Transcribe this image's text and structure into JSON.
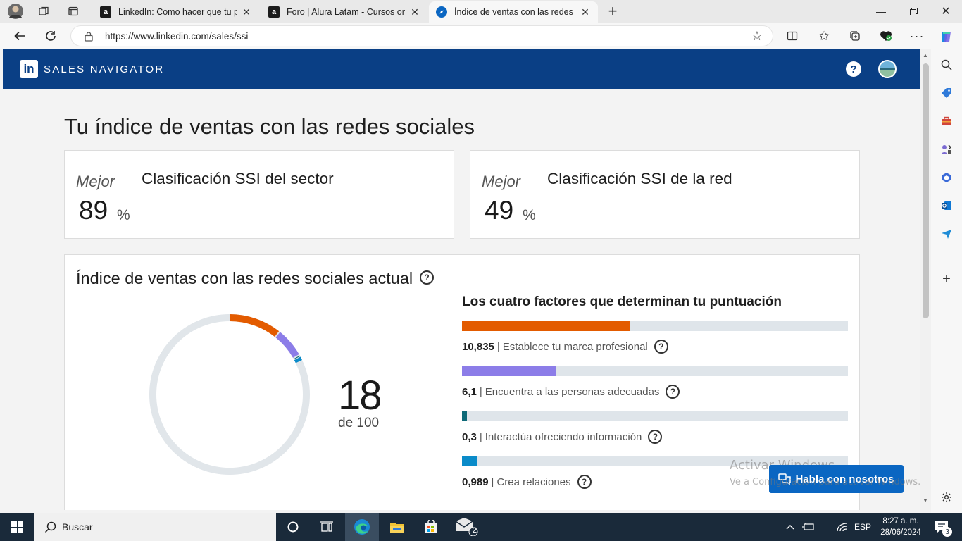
{
  "browser": {
    "tabs": [
      {
        "title": "LinkedIn: Como hacer que tu perfil",
        "favicon": "a",
        "active": false
      },
      {
        "title": "Foro | Alura Latam - Cursos online",
        "favicon": "a",
        "active": false
      },
      {
        "title": "Índice de ventas con las redes sociales",
        "favicon": "compass",
        "active": true
      }
    ],
    "url": "https://www.linkedin.com/sales/ssi"
  },
  "header": {
    "logo": "in",
    "title": "SALES NAVIGATOR",
    "help": "?"
  },
  "page": {
    "title": "Tu índice de ventas con las redes sociales"
  },
  "rankings": [
    {
      "label": "Mejor",
      "value": "89",
      "unit": "%",
      "title": "Clasificación SSI del sector"
    },
    {
      "label": "Mejor",
      "value": "49",
      "unit": "%",
      "title": "Clasificación SSI de la red"
    }
  ],
  "ssi": {
    "title": "Índice de ventas con las redes sociales actual",
    "score": "18",
    "score_of": "de 100",
    "factors_title": "Los cuatro factores que determinan tu puntuación",
    "factors": [
      {
        "value": "10,835",
        "label": "Establece tu marca profesional",
        "fraction": 0.4334,
        "color": "#e35b00"
      },
      {
        "value": "6,1",
        "label": "Encuentra a las personas adecuadas",
        "fraction": 0.244,
        "color": "#8c7de8"
      },
      {
        "value": "0,3",
        "label": "Interactúa ofreciendo información",
        "fraction": 0.012,
        "color": "#0e6a78"
      },
      {
        "value": "0,989",
        "label": "Crea relaciones",
        "fraction": 0.0396,
        "color": "#0a8bc9"
      }
    ],
    "donut_track_color": "#e1e6ea"
  },
  "chat_button": "Habla con nosotros",
  "watermark": {
    "line1": "Activar Windows",
    "line2": "Ve a Configuración para activar Windows."
  },
  "taskbar": {
    "search_placeholder": "Buscar",
    "language": "ESP",
    "time": "8:27 a. m.",
    "date": "28/06/2024",
    "mail_badge": "2",
    "notif_badge": "3"
  },
  "colors": {
    "brand_navy": "#0a3f85",
    "linkedin_blue": "#0a66c2",
    "orange": "#e35b00",
    "purple": "#8c7de8",
    "teal": "#0e6a78",
    "blue": "#0a8bc9"
  }
}
